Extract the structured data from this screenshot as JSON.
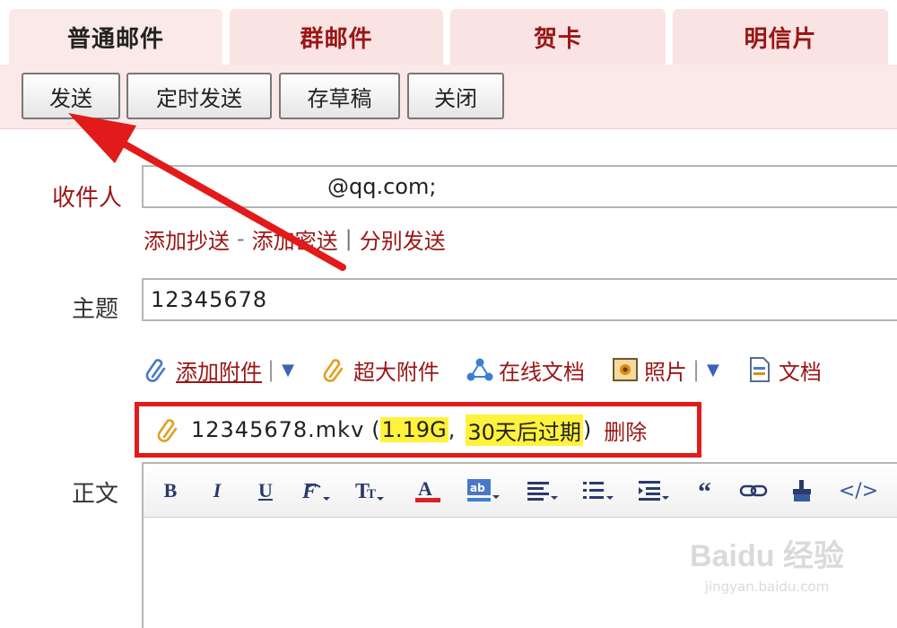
{
  "tabs": [
    {
      "label": "普通邮件",
      "active": true
    },
    {
      "label": "群邮件",
      "active": false
    },
    {
      "label": "贺卡",
      "active": false
    },
    {
      "label": "明信片",
      "active": false
    }
  ],
  "toolbar": {
    "send": "发送",
    "scheduled_send": "定时发送",
    "save_draft": "存草稿",
    "close": "关闭"
  },
  "form": {
    "recipient_label": "收件人",
    "recipient_value": "@qq.com;",
    "add_cc": "添加抄送",
    "add_bcc": "添加密送",
    "separate_send": "分别发送",
    "link_dash": "-",
    "link_pipe": "|",
    "subject_label": "主题",
    "subject_value": "12345678",
    "body_label": "正文"
  },
  "attach_bar": {
    "add_attachment": "添加附件",
    "large_attachment": "超大附件",
    "online_doc": "在线文档",
    "photo": "照片",
    "document": "文档"
  },
  "attachment": {
    "filename": "12345678.mkv",
    "open_paren": "(",
    "size": "1.19G",
    "comma": ",",
    "expiry": "30天后过期",
    "close_paren": ")",
    "delete": "删除"
  },
  "editor_toolbar": {
    "bold": "B",
    "italic": "I",
    "underline": "U",
    "code": "</>"
  },
  "watermark": {
    "logo": "Baidu 经验",
    "url": "jingyan.baidu.com"
  },
  "colors": {
    "accent_red": "#9a1515",
    "highlight_yellow": "#fff23c",
    "annotation_red": "#e21a1a",
    "tab_bg": "#f9e3e3"
  }
}
